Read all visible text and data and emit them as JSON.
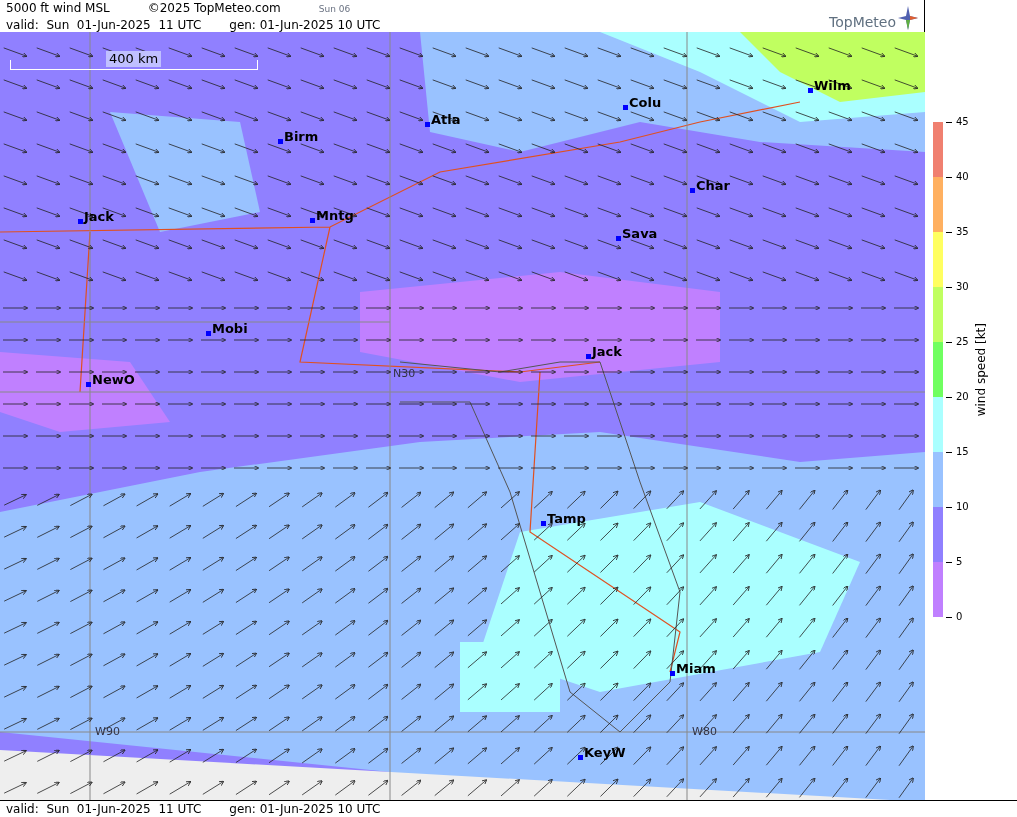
{
  "header": {
    "title": "5000 ft wind MSL",
    "copyright": "©2025 TopMeteo.com",
    "day_tab": "Sun 06",
    "valid": "valid:  Sun  01-Jun-2025  11 UTC",
    "generated": "gen: 01-Jun-2025 10 UTC",
    "logo": "TopMeteo"
  },
  "map": {
    "scale": "400 km",
    "cities": [
      "Atla",
      "Colu",
      "Wilm",
      "Birm",
      "Char",
      "Jack",
      "Mntg",
      "Sava",
      "Mobi",
      "Jack",
      "NewO",
      "Tamp",
      "Miam",
      "KeyW"
    ],
    "grid_labels": [
      "N30",
      "W90",
      "W80"
    ]
  },
  "legend": {
    "title": "wind speed [kt]",
    "ticks": [
      "45",
      "40",
      "35",
      "30",
      "25",
      "20",
      "15",
      "10",
      "5",
      "0"
    ],
    "bands": [
      {
        "color": "#f08070"
      },
      {
        "color": "#ffb060"
      },
      {
        "color": "#ffff60"
      },
      {
        "color": "#c0ff60"
      },
      {
        "color": "#70ff60"
      },
      {
        "color": "#aaffff"
      },
      {
        "color": "#99c2ff"
      },
      {
        "color": "#9080ff"
      },
      {
        "color": "#c080ff"
      }
    ]
  },
  "footer": {
    "valid": "valid:  Sun  01-Jun-2025  11 UTC",
    "generated": "gen: 01-Jun-2025 10 UTC"
  }
}
